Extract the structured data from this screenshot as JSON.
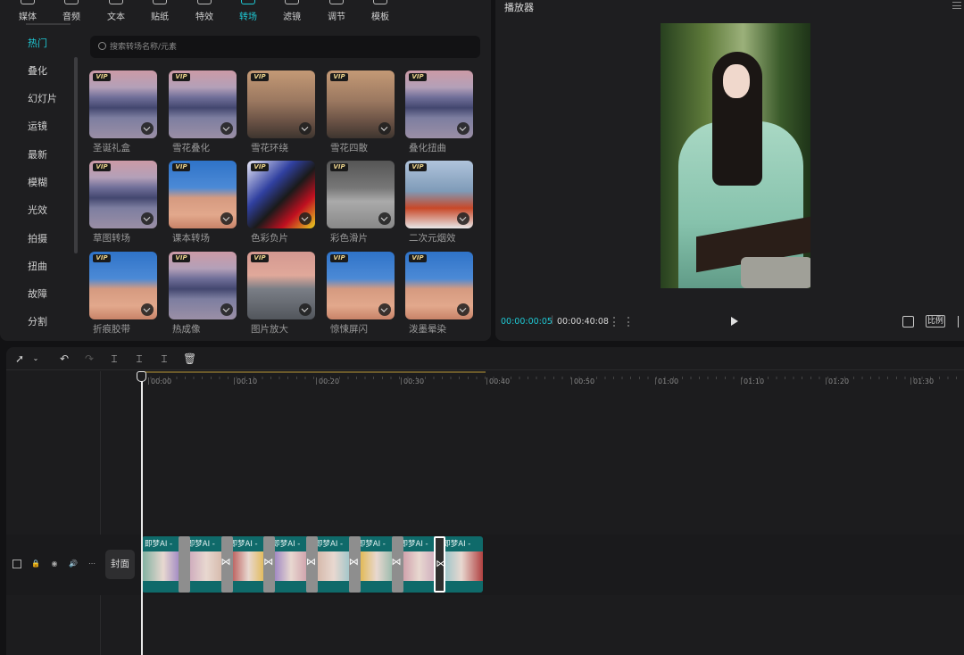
{
  "top_tabs": [
    {
      "label": "媒体",
      "icon": "media-icon"
    },
    {
      "label": "音频",
      "icon": "audio-icon"
    },
    {
      "label": "文本",
      "icon": "text-icon"
    },
    {
      "label": "贴纸",
      "icon": "sticker-icon"
    },
    {
      "label": "特效",
      "icon": "effects-icon"
    },
    {
      "label": "转场",
      "icon": "transition-icon",
      "active": true
    },
    {
      "label": "滤镜",
      "icon": "filter-icon"
    },
    {
      "label": "调节",
      "icon": "adjust-icon"
    },
    {
      "label": "模板",
      "icon": "template-icon"
    }
  ],
  "categories": [
    "热门",
    "叠化",
    "幻灯片",
    "运镜",
    "最新",
    "模糊",
    "光效",
    "拍摄",
    "扭曲",
    "故障",
    "分割"
  ],
  "active_category": "热门",
  "search": {
    "placeholder": "搜索转场名称/元素"
  },
  "transitions": [
    {
      "label": "圣诞礼盒",
      "vip": true
    },
    {
      "label": "雪花叠化",
      "vip": true
    },
    {
      "label": "雪花环绕",
      "vip": true
    },
    {
      "label": "雪花四散",
      "vip": true
    },
    {
      "label": "叠化扭曲",
      "vip": true
    },
    {
      "label": "草图转场",
      "vip": true
    },
    {
      "label": "课本转场",
      "vip": true
    },
    {
      "label": "色彩负片",
      "vip": true
    },
    {
      "label": "彩色滑片",
      "vip": true
    },
    {
      "label": "二次元烟效",
      "vip": true
    },
    {
      "label": "折痕胶带",
      "vip": true
    },
    {
      "label": "热成像",
      "vip": true
    },
    {
      "label": "图片放大",
      "vip": true
    },
    {
      "label": "惊悚屏闪",
      "vip": true
    },
    {
      "label": "泼墨晕染",
      "vip": true
    }
  ],
  "vip_badge": "VIP",
  "player": {
    "title": "播放器",
    "current_time": "00:00:00:05",
    "total_time": "00:00:40:08",
    "ratio_label": "比例"
  },
  "timeline": {
    "ticks": [
      "00:00",
      "00:10",
      "00:20",
      "00:30",
      "00:40",
      "00:50",
      "01:00",
      "01:10",
      "01:20",
      "01:30"
    ],
    "cover_label": "封面",
    "clip_name": "即梦AI -",
    "clip_count": 8
  },
  "colors": {
    "accent": "#1fc8d4",
    "clip_track": "#0f6a6a"
  }
}
